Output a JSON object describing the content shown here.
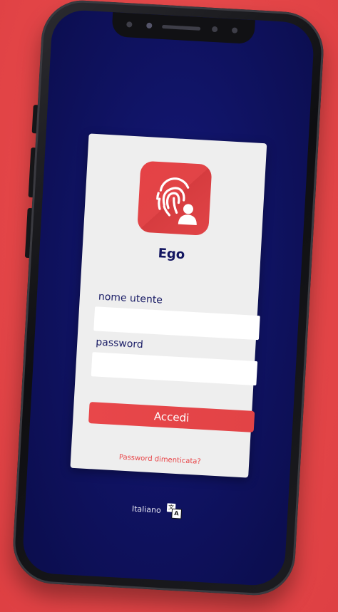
{
  "app": {
    "name": "Ego",
    "logo_icon": "fingerprint-user-icon"
  },
  "login": {
    "username_label": "nome utente",
    "username_value": "",
    "password_label": "password",
    "password_value": "",
    "submit_label": "Accedi",
    "forgot_label": "Password dimenticata?"
  },
  "language": {
    "current": "Italiano",
    "icon": "translate-icon"
  },
  "colors": {
    "background": "#e64a4c",
    "screen": "#11146a",
    "accent": "#e8474a",
    "card": "#eeeeee",
    "title": "#121560"
  }
}
